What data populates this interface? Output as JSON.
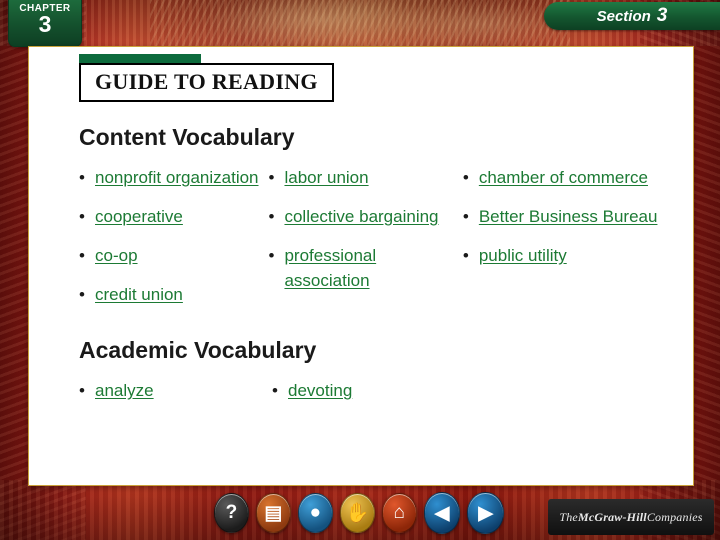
{
  "header": {
    "chapter_label": "CHAPTER",
    "chapter_number": "3",
    "section_word": "Section",
    "section_number": "3"
  },
  "guide": {
    "title": "GUIDE TO READING"
  },
  "content_vocabulary": {
    "heading": "Content Vocabulary",
    "columns": [
      [
        "nonprofit organization",
        "cooperative",
        "co-op",
        "credit union"
      ],
      [
        "labor union",
        "collective bargaining",
        "professional association"
      ],
      [
        "chamber of commerce",
        "Better Business Bureau",
        "public utility"
      ]
    ],
    "bullet": "•"
  },
  "academic_vocabulary": {
    "heading": "Academic Vocabulary",
    "columns": [
      [
        "analyze"
      ],
      [
        "devoting"
      ]
    ]
  },
  "toolbar": {
    "buttons": [
      {
        "name": "help-button",
        "icon": "question-mark-icon",
        "glyph": "?"
      },
      {
        "name": "book-button",
        "icon": "book-icon",
        "glyph": "▤"
      },
      {
        "name": "globe-button",
        "icon": "globe-icon",
        "glyph": "●"
      },
      {
        "name": "hand-button",
        "icon": "hand-icon",
        "glyph": "✋"
      },
      {
        "name": "home-button",
        "icon": "home-icon",
        "glyph": "⌂"
      },
      {
        "name": "previous-button",
        "icon": "chevron-left-icon",
        "glyph": "◀"
      },
      {
        "name": "next-button",
        "icon": "chevron-right-icon",
        "glyph": "▶"
      }
    ]
  },
  "footer": {
    "publisher_prefix": "The ",
    "publisher_name": "McGraw-Hill",
    "publisher_suffix": " Companies"
  },
  "colors": {
    "background_red": "#a51d18",
    "panel_border_gold": "#caa23a",
    "term_green": "#1c7a34",
    "banner_green": "#14562f"
  }
}
